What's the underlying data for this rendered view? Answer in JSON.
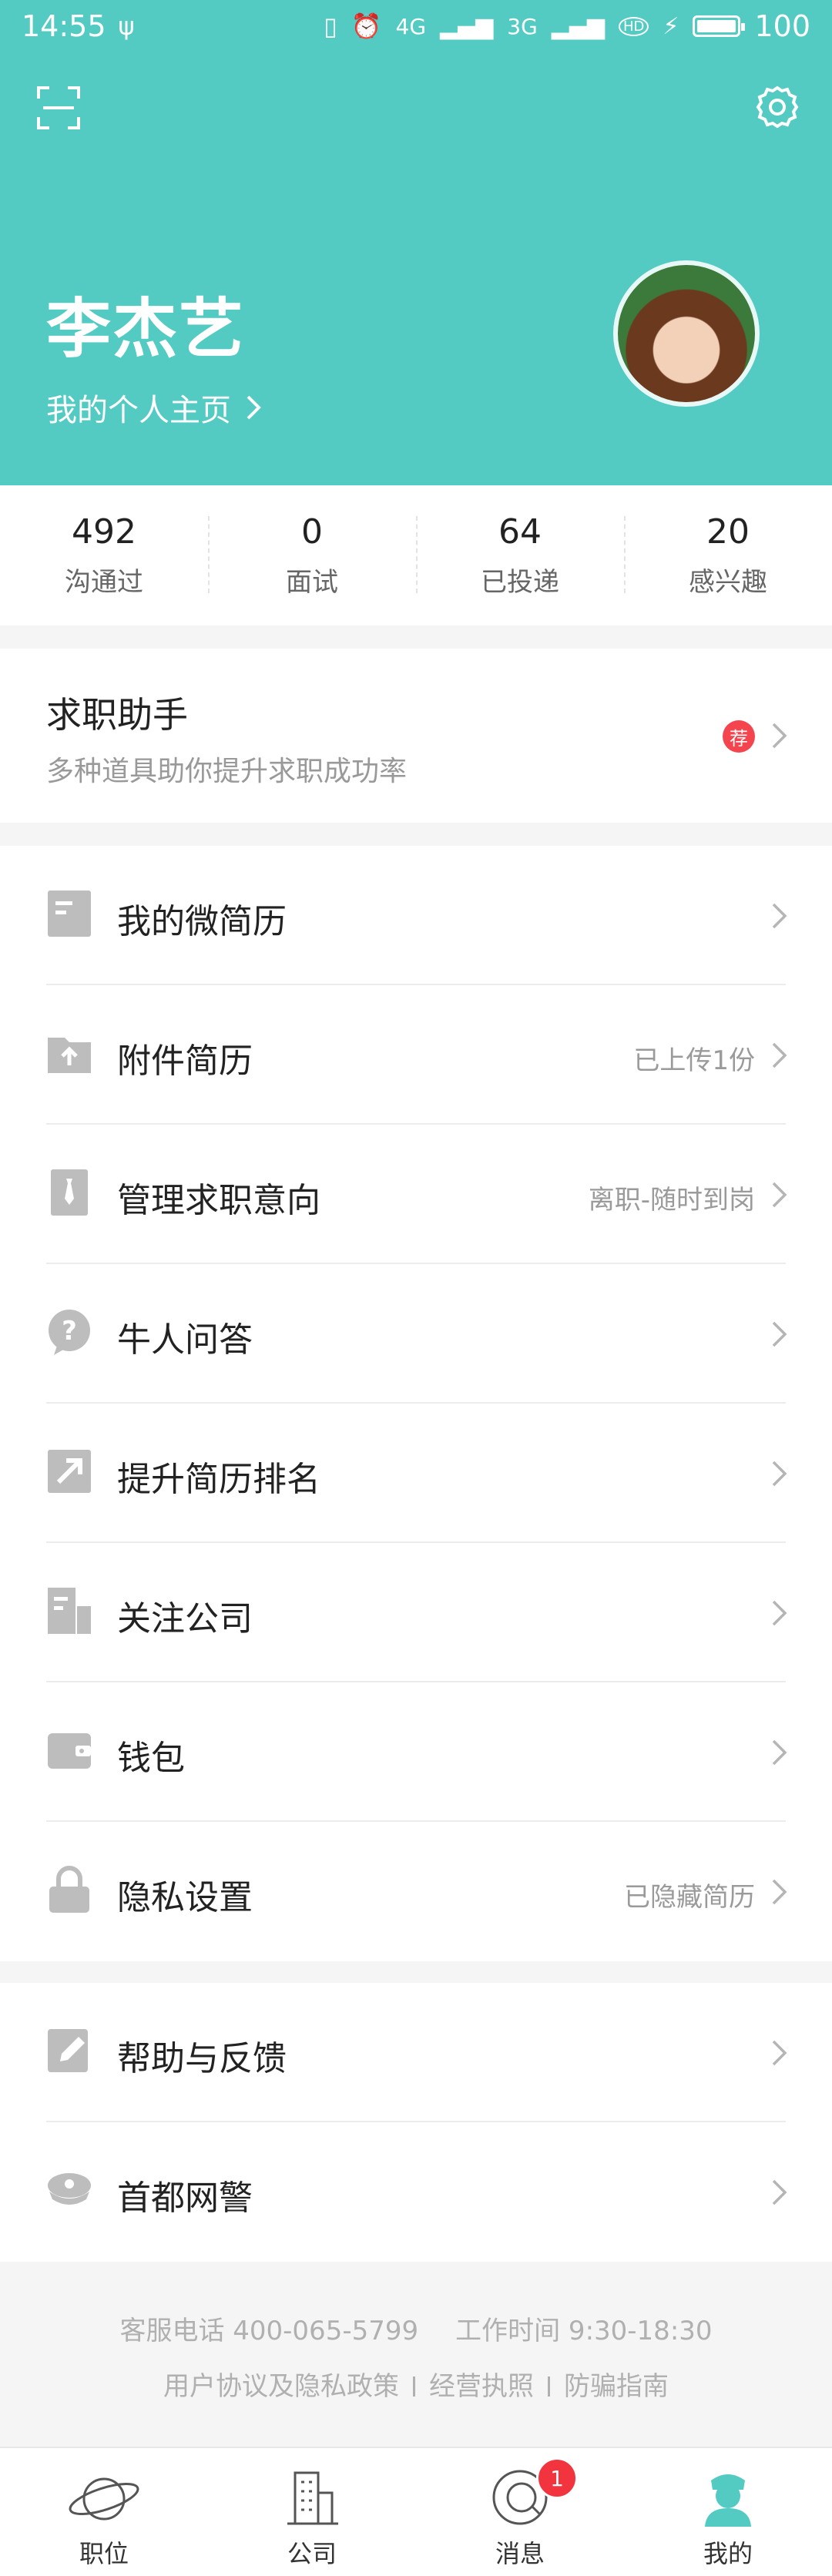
{
  "status_bar": {
    "time": "14:55",
    "network_4g": "4G",
    "network_3g": "3G",
    "hd_label": "HD",
    "battery_level": "100"
  },
  "header": {
    "user_name": "李杰艺",
    "profile_link": "我的个人主页",
    "accent_color": "#53cbc3"
  },
  "stats": [
    {
      "value": "492",
      "label": "沟通过"
    },
    {
      "value": "0",
      "label": "面试"
    },
    {
      "value": "64",
      "label": "已投递"
    },
    {
      "value": "20",
      "label": "感兴趣"
    }
  ],
  "assistant": {
    "title": "求职助手",
    "subtitle": "多种道具助你提升求职成功率",
    "badge": "荐"
  },
  "menu_group_1": [
    {
      "label": "我的微简历",
      "value": "",
      "icon": "resume-icon"
    },
    {
      "label": "附件简历",
      "value": "已上传1份",
      "icon": "upload-folder-icon"
    },
    {
      "label": "管理求职意向",
      "value": "离职-随时到岗",
      "icon": "tie-icon"
    },
    {
      "label": "牛人问答",
      "value": "",
      "icon": "question-bubble-icon"
    },
    {
      "label": "提升简历排名",
      "value": "",
      "icon": "rank-up-icon"
    },
    {
      "label": "关注公司",
      "value": "",
      "icon": "building-icon"
    },
    {
      "label": "钱包",
      "value": "",
      "icon": "wallet-icon"
    },
    {
      "label": "隐私设置",
      "value": "已隐藏简历",
      "icon": "lock-icon"
    }
  ],
  "menu_group_2": [
    {
      "label": "帮助与反馈",
      "value": "",
      "icon": "edit-icon"
    },
    {
      "label": "首都网警",
      "value": "",
      "icon": "police-cap-icon"
    }
  ],
  "footer": {
    "phone": "客服电话 400-065-5799",
    "hours": "工作时间 9:30-18:30",
    "links": [
      "用户协议及隐私政策",
      "经营执照",
      "防骗指南"
    ]
  },
  "tabbar": {
    "tabs": [
      {
        "label": "职位",
        "icon": "planet-icon"
      },
      {
        "label": "公司",
        "icon": "company-building-icon"
      },
      {
        "label": "消息",
        "icon": "chat-bubble-icon",
        "badge": "1"
      },
      {
        "label": "我的",
        "icon": "profile-icon",
        "active": true
      }
    ]
  }
}
